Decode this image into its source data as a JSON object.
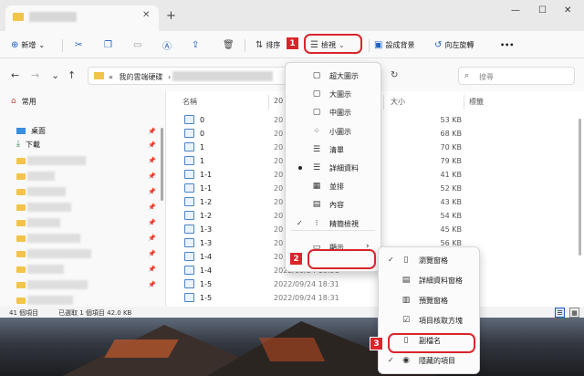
{
  "colors": {
    "accent": "#1f5fbf",
    "highlight": "#d8262b",
    "folder": "#f2c44c"
  },
  "tab": {
    "close": "✕",
    "add": "+"
  },
  "window_controls": {
    "minimize": "—",
    "maximize": "☐",
    "close": "✕"
  },
  "toolbar": {
    "new_label": "新增",
    "sort_label": "排序",
    "view_label": "檢視",
    "set_background_label": "設成背景",
    "rotate_left_label": "向左旋轉",
    "more_label": "•••"
  },
  "address": {
    "back": "←",
    "forward": "→",
    "up_history": "⌄",
    "up": "↑",
    "path_prefix": "«",
    "path_text": "我的雲端硬碟",
    "path_sep": "›",
    "refresh": "↻",
    "search_placeholder": "搜尋"
  },
  "sidebar": {
    "home_label": "常用",
    "desktop_label": "桌面",
    "downloads_label": "下載"
  },
  "columns": {
    "name": "名稱",
    "date": "日期",
    "size": "大小",
    "tags": "標籤"
  },
  "files": [
    {
      "name": "0",
      "size": "53 KB",
      "date": ""
    },
    {
      "name": "0",
      "size": "68 KB",
      "date": ""
    },
    {
      "name": "1",
      "size": "70 KB",
      "date": ""
    },
    {
      "name": "1",
      "size": "79 KB",
      "date": ""
    },
    {
      "name": "1-1",
      "size": "41 KB",
      "date": ""
    },
    {
      "name": "1-1",
      "size": "52 KB",
      "date": ""
    },
    {
      "name": "1-2",
      "size": "43 KB",
      "date": ""
    },
    {
      "name": "1-2",
      "size": "54 KB",
      "date": ""
    },
    {
      "name": "1-3",
      "size": "45 KB",
      "date": ""
    },
    {
      "name": "1-3",
      "size": "56 KB",
      "date": ""
    },
    {
      "name": "1-4",
      "size": "54 KB",
      "date": ""
    },
    {
      "name": "1-4",
      "size": "",
      "date": "2022/09/24 18:31"
    },
    {
      "name": "1-5",
      "size": "",
      "date": "2022/09/24 18:31"
    },
    {
      "name": "1-5",
      "size": "",
      "date": "2022/09/24 18:31"
    }
  ],
  "date_partial": "20",
  "status": {
    "count": "41 個項目",
    "selected": "已選取 1 個項目 42.0 KB"
  },
  "view_menu": {
    "items": [
      {
        "icon": "▢",
        "label": "超大圖示"
      },
      {
        "icon": "▢",
        "label": "大圖示"
      },
      {
        "icon": "▢",
        "label": "中圖示"
      },
      {
        "icon": "⁘",
        "label": "小圖示"
      },
      {
        "icon": "☰",
        "label": "清單"
      },
      {
        "icon": "☰",
        "label": "詳細資料"
      },
      {
        "icon": "▦",
        "label": "並排"
      },
      {
        "icon": "▤",
        "label": "內容"
      },
      {
        "icon": "⁝",
        "label": "精簡檢視"
      },
      {
        "icon": "▭",
        "label": "顯示",
        "arrow": "›"
      }
    ],
    "check": "✓"
  },
  "show_menu": {
    "items": [
      {
        "icon": "▯",
        "label": "瀏覽窗格",
        "check": "✓"
      },
      {
        "icon": "▤",
        "label": "詳細資料窗格",
        "check": ""
      },
      {
        "icon": "▥",
        "label": "預覽窗格",
        "check": ""
      },
      {
        "icon": "☑",
        "label": "項目核取方塊",
        "check": ""
      },
      {
        "icon": "▯",
        "label": "副檔名",
        "check": ""
      },
      {
        "icon": "◉",
        "label": "隱藏的項目",
        "check": "✓"
      }
    ]
  },
  "annotations": {
    "step1": "1",
    "step2": "2",
    "step3": "3"
  }
}
